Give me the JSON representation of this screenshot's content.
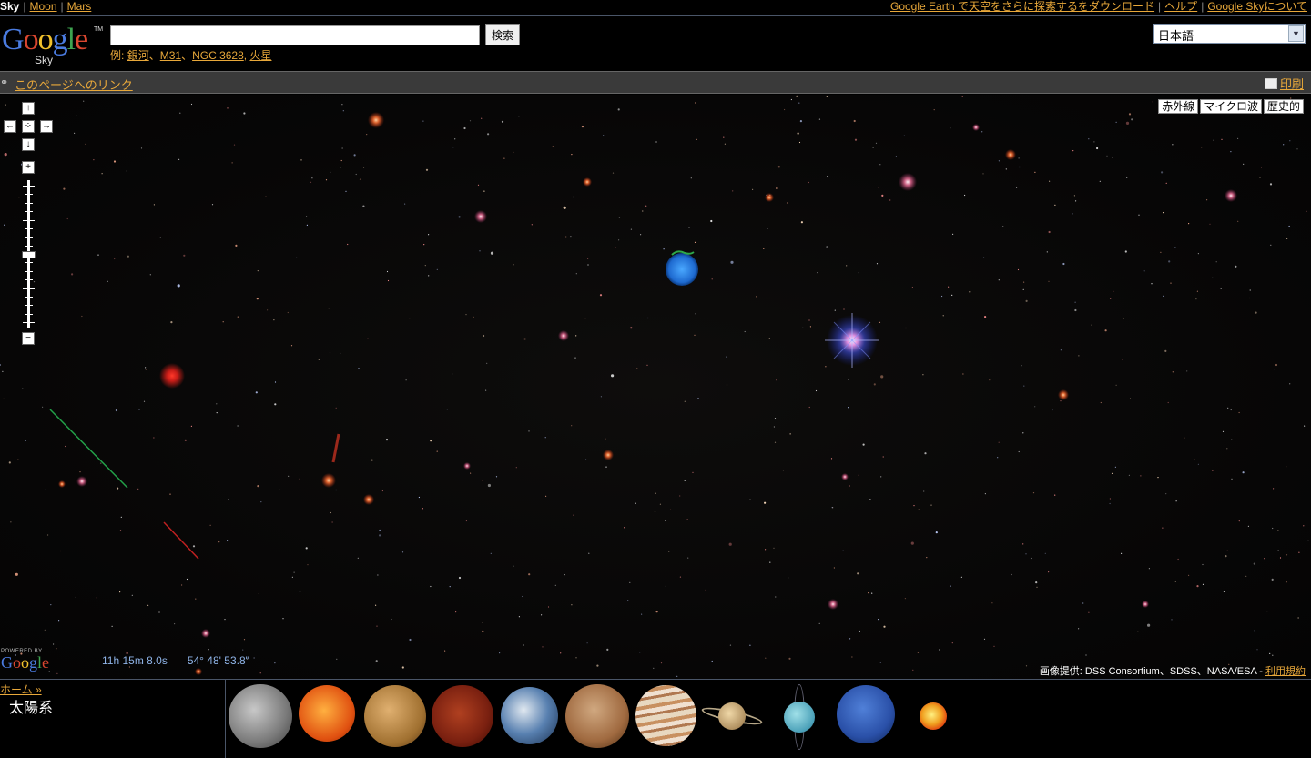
{
  "topnav": {
    "left": [
      {
        "label": "Sky",
        "current": true
      },
      {
        "label": "Moon",
        "current": false
      },
      {
        "label": "Mars",
        "current": false
      }
    ],
    "right": [
      {
        "label": "Google Earth で天空をさらに探索するをダウンロード"
      },
      {
        "label": "ヘルプ"
      },
      {
        "label": "Google Skyについて"
      }
    ]
  },
  "header": {
    "logo_text": "Google",
    "logo_sub": "Sky",
    "logo_tm": "TM",
    "search": {
      "value": "",
      "button_label": "検索"
    },
    "examples_prefix": "例:",
    "examples": [
      "銀河",
      "M31",
      "NGC 3628",
      "火星"
    ],
    "language": "日本語"
  },
  "linkbar": {
    "permalink_label": "このページへのリンク",
    "print_label": "印刷"
  },
  "map": {
    "layers": [
      "赤外線",
      "マイクロ波",
      "歴史的"
    ],
    "nav": {
      "up": "↑",
      "left": "←",
      "center": "⁘",
      "right": "→",
      "down": "↓",
      "zoom_in": "+",
      "zoom_out": "−"
    },
    "zoom_level_fraction": 0.52,
    "powered_by": "POWERED BY",
    "powered_logo": "Google",
    "coords": {
      "ra": "11h 15m 8.0s",
      "dec": "54° 48' 53.8\""
    },
    "credits_prefix": "画像提供: DSS Consortium、SDSS、NASA/ESA -",
    "terms_label": "利用規約"
  },
  "bottom": {
    "home_label": "ホーム »",
    "section_title": "太陽系",
    "planets": [
      "moon",
      "sun",
      "mercury",
      "venus",
      "earth",
      "mars",
      "jupiter",
      "saturn",
      "uranus",
      "neptune",
      "pluto"
    ]
  }
}
